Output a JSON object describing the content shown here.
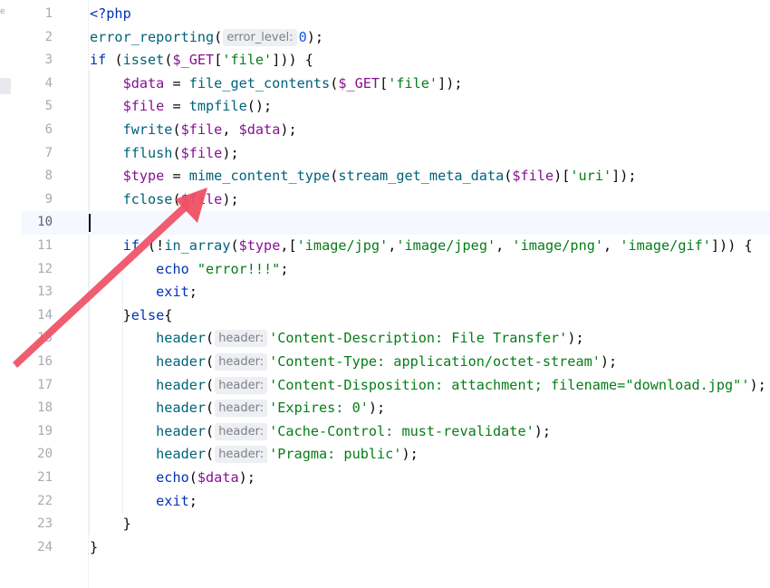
{
  "sidebar": {
    "glyph": "e"
  },
  "editor": {
    "current_line": 10,
    "lines": [
      {
        "num": "1",
        "tokens": [
          [
            "kw",
            "<?php"
          ]
        ]
      },
      {
        "num": "2",
        "tokens": [
          [
            "fn",
            "error_reporting"
          ],
          [
            "pn",
            "("
          ],
          [
            "hint",
            "error_level:"
          ],
          [
            "num",
            "0"
          ],
          [
            "pn",
            ");"
          ]
        ]
      },
      {
        "num": "3",
        "tokens": [
          [
            "kw",
            "if"
          ],
          [
            "pn",
            " ("
          ],
          [
            "fn",
            "isset"
          ],
          [
            "pn",
            "("
          ],
          [
            "var",
            "$_GET"
          ],
          [
            "pn",
            "["
          ],
          [
            "str",
            "'file'"
          ],
          [
            "pn",
            "])) {"
          ]
        ]
      },
      {
        "num": "4",
        "tokens": [
          [
            "pn",
            "    "
          ],
          [
            "var",
            "$data"
          ],
          [
            "pn",
            " = "
          ],
          [
            "fn",
            "file_get_contents"
          ],
          [
            "pn",
            "("
          ],
          [
            "var",
            "$_GET"
          ],
          [
            "pn",
            "["
          ],
          [
            "str",
            "'file'"
          ],
          [
            "pn",
            "]);"
          ]
        ]
      },
      {
        "num": "5",
        "tokens": [
          [
            "pn",
            "    "
          ],
          [
            "var",
            "$file"
          ],
          [
            "pn",
            " = "
          ],
          [
            "fn",
            "tmpfile"
          ],
          [
            "pn",
            "();"
          ]
        ]
      },
      {
        "num": "6",
        "tokens": [
          [
            "pn",
            "    "
          ],
          [
            "fn",
            "fwrite"
          ],
          [
            "pn",
            "("
          ],
          [
            "var",
            "$file"
          ],
          [
            "pn",
            ", "
          ],
          [
            "var",
            "$data"
          ],
          [
            "pn",
            ");"
          ]
        ]
      },
      {
        "num": "7",
        "tokens": [
          [
            "pn",
            "    "
          ],
          [
            "fn",
            "fflush"
          ],
          [
            "pn",
            "("
          ],
          [
            "var",
            "$file"
          ],
          [
            "pn",
            ");"
          ]
        ]
      },
      {
        "num": "8",
        "tokens": [
          [
            "pn",
            "    "
          ],
          [
            "var",
            "$type"
          ],
          [
            "pn",
            " = "
          ],
          [
            "fn",
            "mime_content_type"
          ],
          [
            "pn",
            "("
          ],
          [
            "fn",
            "stream_get_meta_data"
          ],
          [
            "pn",
            "("
          ],
          [
            "var",
            "$file"
          ],
          [
            "pn",
            ")["
          ],
          [
            "str",
            "'uri'"
          ],
          [
            "pn",
            "]);"
          ]
        ]
      },
      {
        "num": "9",
        "tokens": [
          [
            "pn",
            "    "
          ],
          [
            "fn",
            "fclose"
          ],
          [
            "pn",
            "("
          ],
          [
            "var",
            "$file"
          ],
          [
            "pn",
            ");"
          ]
        ]
      },
      {
        "num": "10",
        "tokens": []
      },
      {
        "num": "11",
        "tokens": [
          [
            "pn",
            "    "
          ],
          [
            "kw",
            "if"
          ],
          [
            "pn",
            " (!"
          ],
          [
            "fn",
            "in_array"
          ],
          [
            "pn",
            "("
          ],
          [
            "var",
            "$type"
          ],
          [
            "pn",
            ",["
          ],
          [
            "str",
            "'image/jpg'"
          ],
          [
            "pn",
            ","
          ],
          [
            "str",
            "'image/jpeg'"
          ],
          [
            "pn",
            ", "
          ],
          [
            "str",
            "'image/png'"
          ],
          [
            "pn",
            ", "
          ],
          [
            "str",
            "'image/gif'"
          ],
          [
            "pn",
            "])) {"
          ]
        ]
      },
      {
        "num": "12",
        "tokens": [
          [
            "pn",
            "        "
          ],
          [
            "kw",
            "echo"
          ],
          [
            "pn",
            " "
          ],
          [
            "str",
            "\"error!!!\""
          ],
          [
            "pn",
            ";"
          ]
        ]
      },
      {
        "num": "13",
        "tokens": [
          [
            "pn",
            "        "
          ],
          [
            "kw",
            "exit"
          ],
          [
            "pn",
            ";"
          ]
        ]
      },
      {
        "num": "14",
        "tokens": [
          [
            "pn",
            "    }"
          ],
          [
            "kw",
            "else"
          ],
          [
            "pn",
            "{"
          ]
        ]
      },
      {
        "num": "15",
        "tokens": [
          [
            "pn",
            "        "
          ],
          [
            "fn",
            "header"
          ],
          [
            "pn",
            "("
          ],
          [
            "hint",
            "header:"
          ],
          [
            "str",
            "'Content-Description: File Transfer'"
          ],
          [
            "pn",
            ");"
          ]
        ]
      },
      {
        "num": "16",
        "tokens": [
          [
            "pn",
            "        "
          ],
          [
            "fn",
            "header"
          ],
          [
            "pn",
            "("
          ],
          [
            "hint",
            "header:"
          ],
          [
            "str",
            "'Content-Type: application/octet-stream'"
          ],
          [
            "pn",
            ");"
          ]
        ]
      },
      {
        "num": "17",
        "tokens": [
          [
            "pn",
            "        "
          ],
          [
            "fn",
            "header"
          ],
          [
            "pn",
            "("
          ],
          [
            "hint",
            "header:"
          ],
          [
            "str",
            "'Content-Disposition: attachment; filename=\"download.jpg\"'"
          ],
          [
            "pn",
            ");"
          ]
        ]
      },
      {
        "num": "18",
        "tokens": [
          [
            "pn",
            "        "
          ],
          [
            "fn",
            "header"
          ],
          [
            "pn",
            "("
          ],
          [
            "hint",
            "header:"
          ],
          [
            "str",
            "'Expires: 0'"
          ],
          [
            "pn",
            ");"
          ]
        ]
      },
      {
        "num": "19",
        "tokens": [
          [
            "pn",
            "        "
          ],
          [
            "fn",
            "header"
          ],
          [
            "pn",
            "("
          ],
          [
            "hint",
            "header:"
          ],
          [
            "str",
            "'Cache-Control: must-revalidate'"
          ],
          [
            "pn",
            ");"
          ]
        ]
      },
      {
        "num": "20",
        "tokens": [
          [
            "pn",
            "        "
          ],
          [
            "fn",
            "header"
          ],
          [
            "pn",
            "("
          ],
          [
            "hint",
            "header:"
          ],
          [
            "str",
            "'Pragma: public'"
          ],
          [
            "pn",
            ");"
          ]
        ]
      },
      {
        "num": "21",
        "tokens": [
          [
            "pn",
            "        "
          ],
          [
            "kw",
            "echo"
          ],
          [
            "pn",
            "("
          ],
          [
            "var",
            "$data"
          ],
          [
            "pn",
            ");"
          ]
        ]
      },
      {
        "num": "22",
        "tokens": [
          [
            "pn",
            "        "
          ],
          [
            "kw",
            "exit"
          ],
          [
            "pn",
            ";"
          ]
        ]
      },
      {
        "num": "23",
        "tokens": [
          [
            "pn",
            "    }"
          ]
        ]
      },
      {
        "num": "24",
        "tokens": [
          [
            "pn",
            "}"
          ]
        ]
      }
    ]
  },
  "colors": {
    "keyword": "#0033b3",
    "function": "#00627a",
    "variable": "#871094",
    "string": "#067d17",
    "number": "#1750eb",
    "current_line_bg": "#f5f8fe",
    "arrow": "#ef4f64"
  }
}
